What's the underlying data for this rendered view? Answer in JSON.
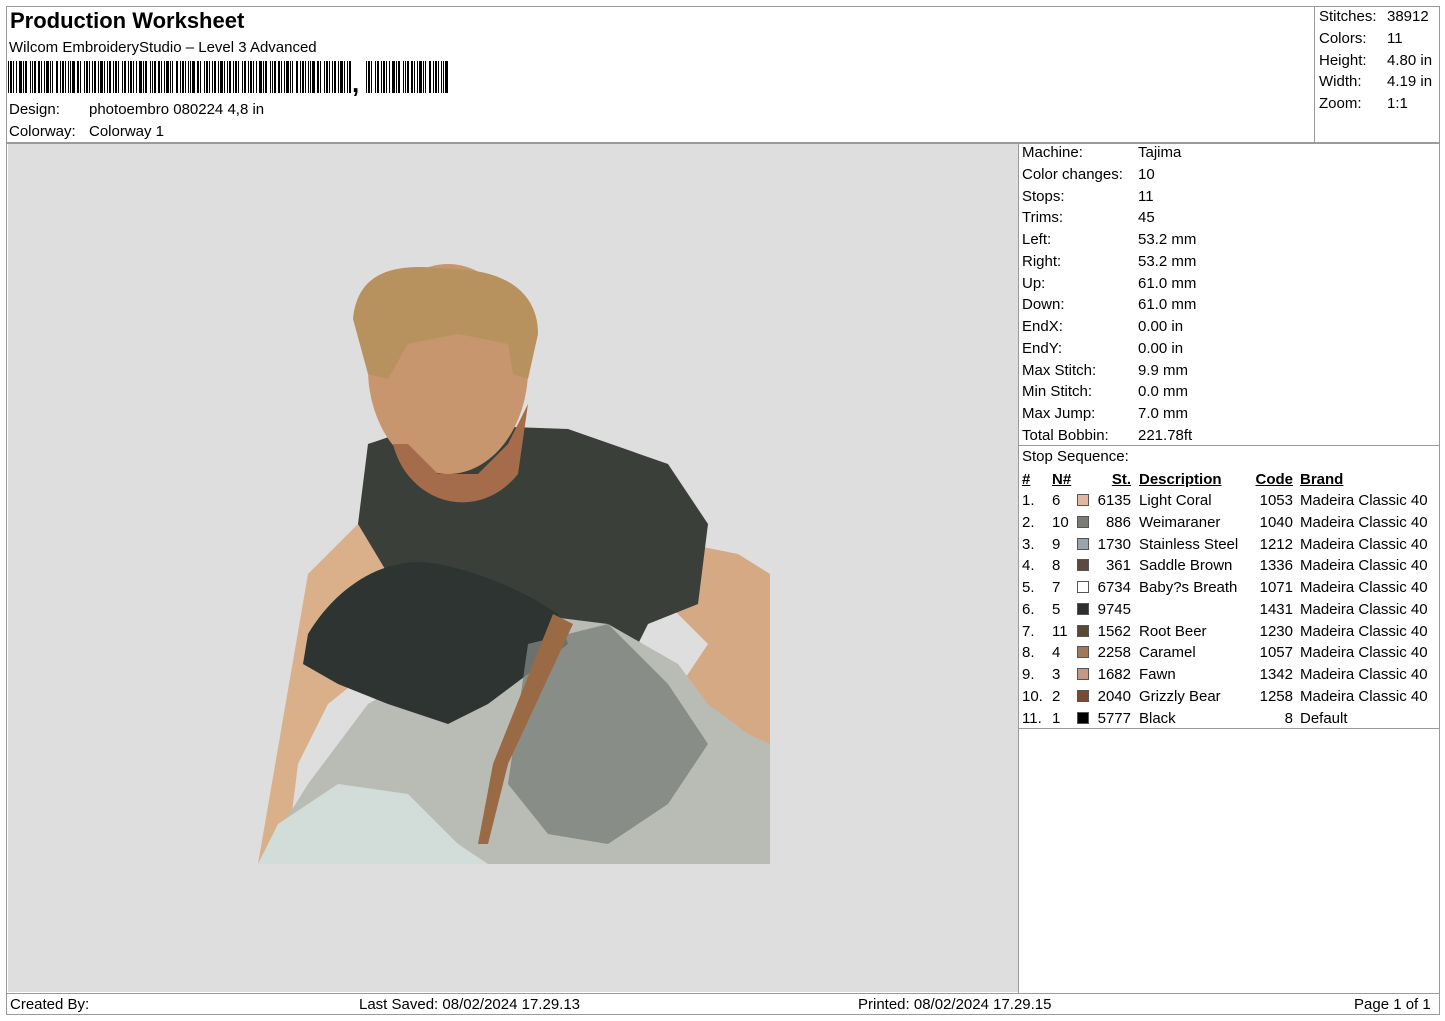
{
  "header": {
    "title": "Production Worksheet",
    "software": "Wilcom EmbroideryStudio – Level 3 Advanced",
    "barcode_tail": ",",
    "design_label": "Design:",
    "design_value": "photoembro 080224 4,8 in",
    "colorway_label": "Colorway:",
    "colorway_value": "Colorway 1"
  },
  "summary": [
    {
      "label": "Stitches:",
      "value": "38912"
    },
    {
      "label": "Colors:",
      "value": "11"
    },
    {
      "label": "Height:",
      "value": "4.80 in"
    },
    {
      "label": "Width:",
      "value": "4.19 in"
    },
    {
      "label": "Zoom:",
      "value": "1:1"
    }
  ],
  "machine_info": [
    {
      "label": "Machine:",
      "value": "Tajima"
    },
    {
      "label": "Color changes:",
      "value": "10"
    },
    {
      "label": "Stops:",
      "value": "11"
    },
    {
      "label": "Trims:",
      "value": "45"
    },
    {
      "label": "Left:",
      "value": "53.2 mm"
    },
    {
      "label": "Right:",
      "value": "53.2 mm"
    },
    {
      "label": "Up:",
      "value": "61.0 mm"
    },
    {
      "label": "Down:",
      "value": "61.0 mm"
    },
    {
      "label": "EndX:",
      "value": "0.00 in"
    },
    {
      "label": "EndY:",
      "value": "0.00 in"
    },
    {
      "label": "Max Stitch:",
      "value": "9.9 mm"
    },
    {
      "label": "Min Stitch:",
      "value": "0.0 mm"
    },
    {
      "label": "Max Jump:",
      "value": "7.0 mm"
    },
    {
      "label": "Total Bobbin:",
      "value": "221.78ft"
    }
  ],
  "stop_sequence": {
    "title": "Stop Sequence:",
    "columns": {
      "num": "#",
      "n": "N#",
      "st": "St.",
      "description": "Description",
      "code": "Code",
      "brand": "Brand"
    },
    "rows": [
      {
        "num": "1.",
        "n": "6",
        "color": "#e3b6a0",
        "st": "6135",
        "description": "Light Coral",
        "code": "1053",
        "brand": "Madeira Classic 40"
      },
      {
        "num": "2.",
        "n": "10",
        "color": "#7b7b78",
        "st": "886",
        "description": "Weimaraner",
        "code": "1040",
        "brand": "Madeira Classic 40"
      },
      {
        "num": "3.",
        "n": "9",
        "color": "#9aa4aa",
        "st": "1730",
        "description": "Stainless Steel",
        "code": "1212",
        "brand": "Madeira Classic 40"
      },
      {
        "num": "4.",
        "n": "8",
        "color": "#5a4a40",
        "st": "361",
        "description": "Saddle Brown",
        "code": "1336",
        "brand": "Madeira Classic 40"
      },
      {
        "num": "5.",
        "n": "7",
        "color": "#ffffff",
        "st": "6734",
        "description": "Baby?s Breath",
        "code": "1071",
        "brand": "Madeira Classic 40"
      },
      {
        "num": "6.",
        "n": "5",
        "color": "#2e2e2e",
        "st": "9745",
        "description": "",
        "code": "1431",
        "brand": "Madeira Classic 40"
      },
      {
        "num": "7.",
        "n": "11",
        "color": "#5a4835",
        "st": "1562",
        "description": "Root Beer",
        "code": "1230",
        "brand": "Madeira Classic 40"
      },
      {
        "num": "8.",
        "n": "4",
        "color": "#a0785a",
        "st": "2258",
        "description": "Caramel",
        "code": "1057",
        "brand": "Madeira Classic 40"
      },
      {
        "num": "9.",
        "n": "3",
        "color": "#c09a86",
        "st": "1682",
        "description": "Fawn",
        "code": "1342",
        "brand": "Madeira Classic 40"
      },
      {
        "num": "10.",
        "n": "2",
        "color": "#7a4a30",
        "st": "2040",
        "description": "Grizzly Bear",
        "code": "1258",
        "brand": "Madeira Classic 40"
      },
      {
        "num": "11.",
        "n": "1",
        "color": "#000000",
        "st": "5777",
        "description": "Black",
        "code": "8",
        "brand": "Default"
      }
    ]
  },
  "footer": {
    "created_by": "Created By:",
    "last_saved": "Last Saved: 08/02/2024 17.29.13",
    "printed": "Printed: 08/02/2024 17.29.15",
    "page": "Page 1 of 1"
  }
}
